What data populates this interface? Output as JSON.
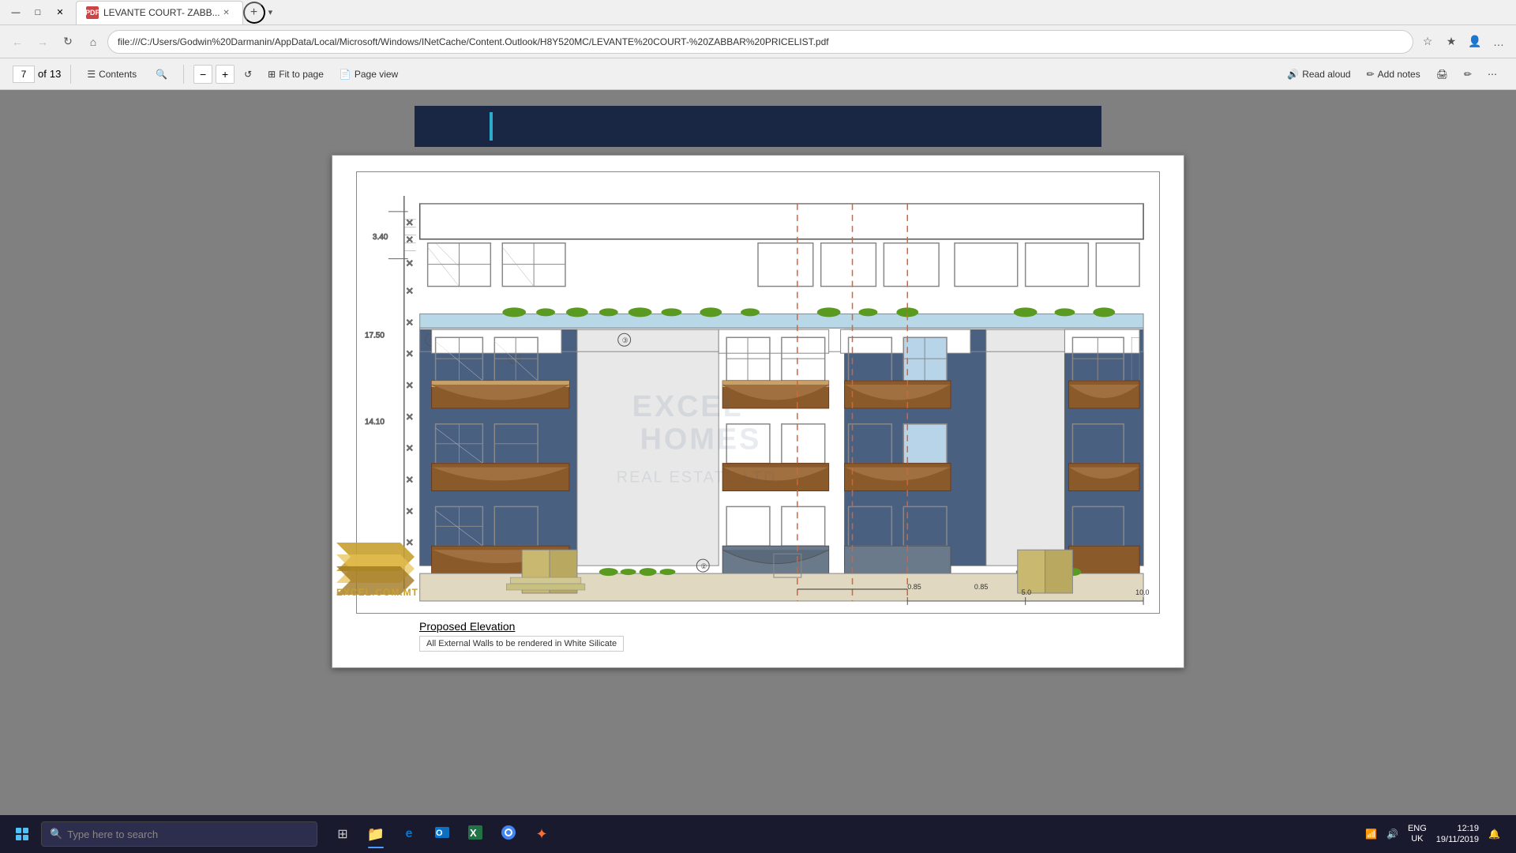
{
  "browser": {
    "title": "LEVANTE COURT- ZABB...",
    "tab_label": "LEVANTE COURT- ZABB...",
    "url": "file:///C:/Users/Godwin%20Darmanin/AppData/Local/Microsoft/Windows/INetCache/Content.Outlook/H8Y520MC/LEVANTE%20COURT-%20ZABBAR%20PRICELIST.pdf",
    "back_btn": "←",
    "forward_btn": "→",
    "refresh_btn": "↻",
    "home_btn": "⌂",
    "star_btn": "☆",
    "fav_btn": "★",
    "close_btn": "✕",
    "minimize_btn": "—",
    "maximize_btn": "□",
    "new_tab_btn": "+"
  },
  "pdf_toolbar": {
    "page_current": "7",
    "page_total": "13",
    "contents_label": "Contents",
    "search_icon": "🔍",
    "zoom_out": "−",
    "zoom_in": "+",
    "rotate_label": "↺",
    "fit_page_label": "Fit to page",
    "page_view_label": "Page view",
    "read_aloud_label": "Read aloud",
    "add_notes_label": "Add notes",
    "print_icon": "🖨",
    "draw_icon": "✏",
    "more_icon": "⋯"
  },
  "drawing": {
    "title": "Proposed Elevation",
    "note": "All External Walls to be rendered in White Silicate",
    "measurement_left_top": "3.40",
    "measurement_left_mid": "17.50",
    "measurement_left_bot": "14.10",
    "measurement_bottom_1": "0.85",
    "measurement_bottom_2": "0.85",
    "scale_label_5": "5.0",
    "scale_label_10": "10.0"
  },
  "watermark": {
    "line1": "EXCEL HOMES",
    "line2": "REAL ESTATE LTD"
  },
  "logo": {
    "text": "EXCEL.COM.MT"
  },
  "taskbar": {
    "search_placeholder": "Type here to search",
    "language": "ENG\nUK",
    "time": "12:19",
    "date": "19/11/2019",
    "taskbar_items": [
      {
        "name": "task-view",
        "icon": "⊞"
      },
      {
        "name": "file-explorer",
        "icon": "📁"
      },
      {
        "name": "edge-browser",
        "icon": "e"
      },
      {
        "name": "outlook",
        "icon": "O"
      },
      {
        "name": "excel-app",
        "icon": "X"
      },
      {
        "name": "chrome",
        "icon": "◉"
      },
      {
        "name": "other-app",
        "icon": "✦"
      }
    ]
  }
}
